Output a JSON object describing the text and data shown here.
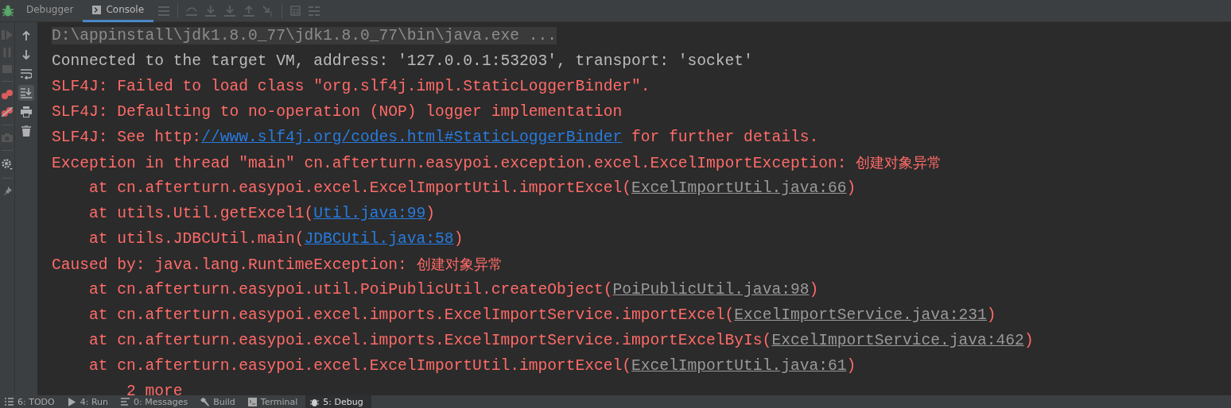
{
  "tabs": [
    {
      "label": "Debugger",
      "selected": false
    },
    {
      "label": "Console",
      "selected": true
    }
  ],
  "console_toolbar": [
    {
      "selected": false
    },
    {
      "selected": false
    },
    {
      "selected": false
    },
    {
      "selected": true
    },
    {
      "selected": false
    },
    {
      "selected": false
    }
  ],
  "console": [
    {
      "kind": "info",
      "highlighted": true,
      "segments": [
        {
          "kind": "text",
          "text": "D:\\appinstall\\jdk1.8.0_77\\jdk1.8.0_77\\bin\\java.exe ..."
        }
      ]
    },
    {
      "kind": "plain",
      "highlighted": false,
      "segments": [
        {
          "kind": "text",
          "text": "Connected to the target VM, address: '127.0.0.1:53203', transport: 'socket'"
        }
      ]
    },
    {
      "kind": "error",
      "highlighted": false,
      "segments": [
        {
          "kind": "text",
          "text": "SLF4J: Failed to load class \"org.slf4j.impl.StaticLoggerBinder\"."
        }
      ]
    },
    {
      "kind": "error",
      "highlighted": false,
      "segments": [
        {
          "kind": "text",
          "text": "SLF4J: Defaulting to no-operation (NOP) logger implementation"
        }
      ]
    },
    {
      "kind": "error",
      "highlighted": false,
      "segments": [
        {
          "kind": "text",
          "text": "SLF4J: See http:"
        },
        {
          "kind": "link",
          "text": "//www.slf4j.org/codes.html#StaticLoggerBinder"
        },
        {
          "kind": "text",
          "text": " for further details."
        }
      ]
    },
    {
      "kind": "error",
      "highlighted": false,
      "segments": [
        {
          "kind": "text",
          "text": "Exception in thread \"main\" cn.afterturn.easypoi.exception.excel.ExcelImportException: "
        },
        {
          "kind": "cjk",
          "text": "创建对象异常"
        }
      ]
    },
    {
      "kind": "error",
      "highlighted": false,
      "segments": [
        {
          "kind": "text",
          "text": "    at cn.afterturn.easypoi.excel.ExcelImportUtil.importExcel("
        },
        {
          "kind": "source",
          "text": "ExcelImportUtil.java:66"
        },
        {
          "kind": "text",
          "text": ")"
        }
      ]
    },
    {
      "kind": "error",
      "highlighted": false,
      "segments": [
        {
          "kind": "text",
          "text": "    at utils.Util.getExcel1("
        },
        {
          "kind": "link",
          "text": "Util.java:99"
        },
        {
          "kind": "text",
          "text": ")"
        }
      ]
    },
    {
      "kind": "error",
      "highlighted": false,
      "segments": [
        {
          "kind": "text",
          "text": "    at utils.JDBCUtil.main("
        },
        {
          "kind": "link",
          "text": "JDBCUtil.java:58"
        },
        {
          "kind": "text",
          "text": ")"
        }
      ]
    },
    {
      "kind": "error",
      "highlighted": false,
      "segments": [
        {
          "kind": "text",
          "text": "Caused by: java.lang.RuntimeException: "
        },
        {
          "kind": "cjk",
          "text": "创建对象异常"
        }
      ]
    },
    {
      "kind": "error",
      "highlighted": false,
      "segments": [
        {
          "kind": "text",
          "text": "    at cn.afterturn.easypoi.util.PoiPublicUtil.createObject("
        },
        {
          "kind": "source",
          "text": "PoiPublicUtil.java:98"
        },
        {
          "kind": "text",
          "text": ")"
        }
      ]
    },
    {
      "kind": "error",
      "highlighted": false,
      "segments": [
        {
          "kind": "text",
          "text": "    at cn.afterturn.easypoi.excel.imports.ExcelImportService.importExcel("
        },
        {
          "kind": "source",
          "text": "ExcelImportService.java:231"
        },
        {
          "kind": "text",
          "text": ")"
        }
      ]
    },
    {
      "kind": "error",
      "highlighted": false,
      "segments": [
        {
          "kind": "text",
          "text": "    at cn.afterturn.easypoi.excel.imports.ExcelImportService.importExcelByIs("
        },
        {
          "kind": "source",
          "text": "ExcelImportService.java:462"
        },
        {
          "kind": "text",
          "text": ")"
        }
      ]
    },
    {
      "kind": "error",
      "highlighted": false,
      "segments": [
        {
          "kind": "text",
          "text": "    at cn.afterturn.easypoi.excel.ExcelImportUtil.importExcel("
        },
        {
          "kind": "source",
          "text": "ExcelImportUtil.java:61"
        },
        {
          "kind": "text",
          "text": ")"
        }
      ]
    },
    {
      "kind": "error",
      "highlighted": false,
      "segments": [
        {
          "kind": "text",
          "text": "        2 more"
        }
      ]
    }
  ],
  "tool_windows": [
    {
      "label": "6: TODO",
      "selected": false
    },
    {
      "label": "4: Run",
      "selected": false
    },
    {
      "label": "0: Messages",
      "selected": false
    },
    {
      "label": "Build",
      "selected": false
    },
    {
      "label": "Terminal",
      "selected": false
    },
    {
      "label": "5: Debug",
      "selected": true
    }
  ]
}
